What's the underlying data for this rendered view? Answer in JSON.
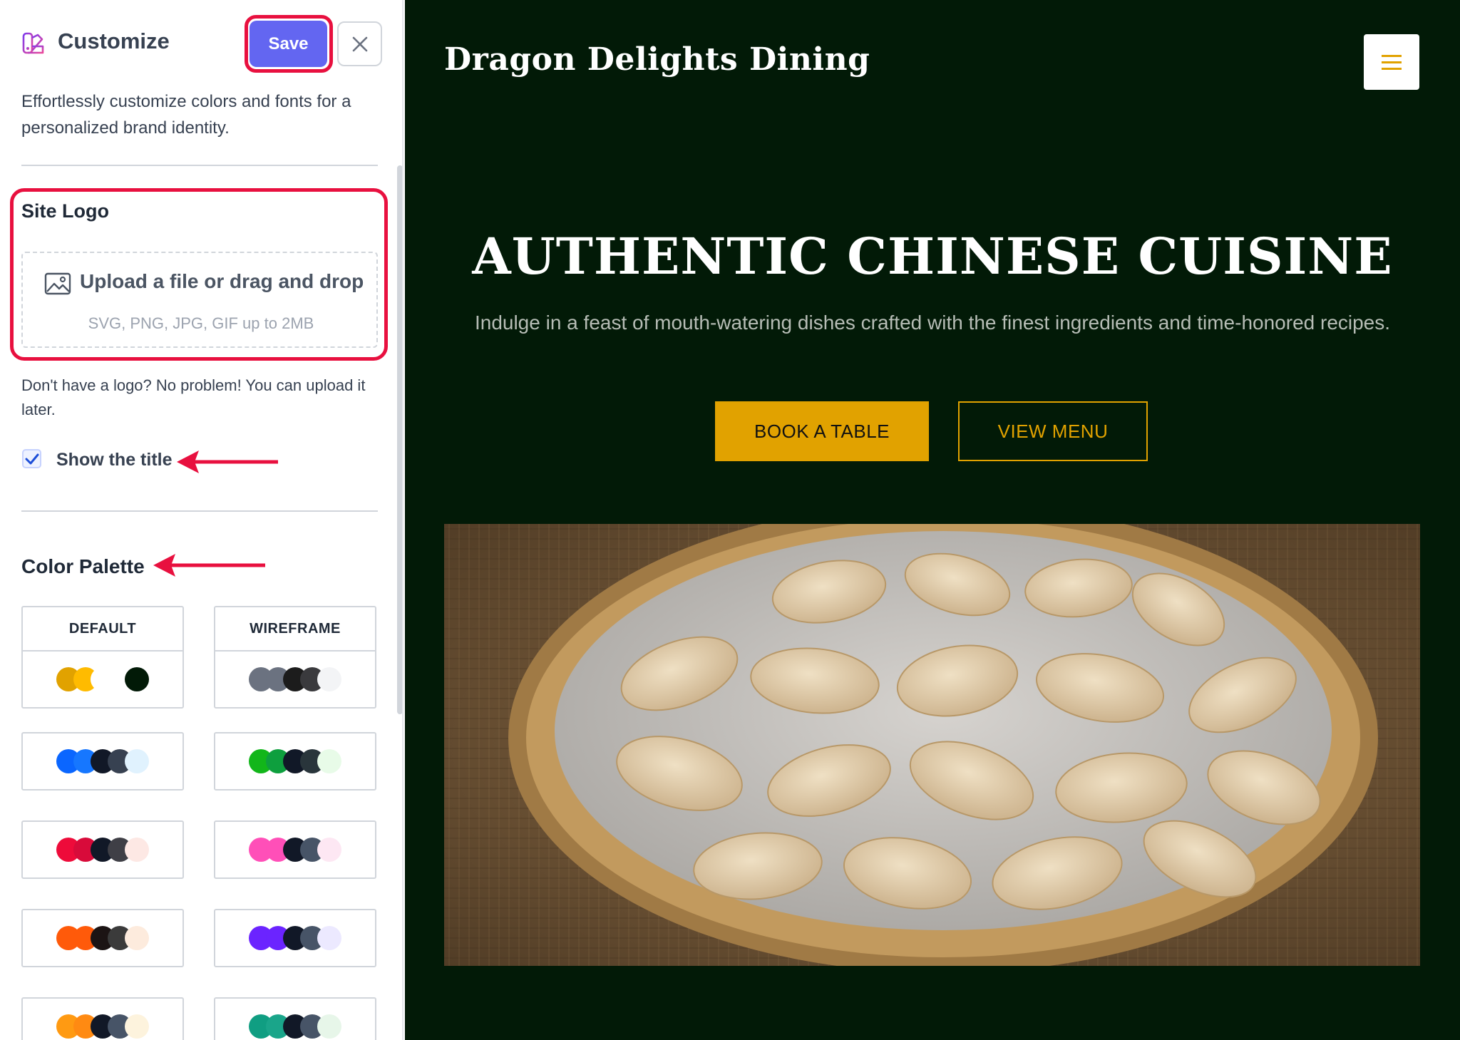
{
  "sidebar": {
    "title": "Customize",
    "save_label": "Save",
    "description": "Effortlessly customize colors and fonts for a personalized brand identity.",
    "site_logo": {
      "title": "Site Logo",
      "upload_text": "Upload a file or drag and drop",
      "upload_hint": "SVG, PNG, JPG, GIF up to 2MB",
      "note": "Don't have a logo? No problem! You can upload it later."
    },
    "show_title": {
      "label": "Show the title",
      "checked": true
    },
    "palette": {
      "title": "Color Palette",
      "options": [
        {
          "name": "DEFAULT",
          "colors": [
            "#e1a200",
            "#ffbb00",
            "#ffffff",
            "#ffffff",
            "#021a07"
          ]
        },
        {
          "name": "WIREFRAME",
          "colors": [
            "#6b7280",
            "#6b7280",
            "#1c1c1c",
            "#3a3a3d",
            "#f3f4f6"
          ]
        },
        {
          "name": "",
          "colors": [
            "#0a66ff",
            "#1677ff",
            "#111827",
            "#374151",
            "#e0f2fe"
          ]
        },
        {
          "name": "",
          "colors": [
            "#12b61a",
            "#0e9f3e",
            "#111827",
            "#29353b",
            "#e8fbe8"
          ]
        },
        {
          "name": "",
          "colors": [
            "#ee0b3a",
            "#d80b3a",
            "#111827",
            "#3f3f46",
            "#fde8e4"
          ]
        },
        {
          "name": "",
          "colors": [
            "#ff4fb8",
            "#ff4fb8",
            "#111827",
            "#475467",
            "#fde7f3"
          ]
        },
        {
          "name": "",
          "colors": [
            "#ff5a0a",
            "#ff5a0a",
            "#1c1414",
            "#3b3b3b",
            "#fdebdd"
          ]
        },
        {
          "name": "",
          "colors": [
            "#6b24ff",
            "#6b24ff",
            "#111827",
            "#475467",
            "#ece9ff"
          ]
        },
        {
          "name": "",
          "colors": [
            "#ff9a12",
            "#ff8a12",
            "#111827",
            "#475467",
            "#fdf3dd"
          ]
        },
        {
          "name": "",
          "colors": [
            "#109e82",
            "#1aa58a",
            "#111827",
            "#475467",
            "#e7f6e9"
          ]
        }
      ]
    }
  },
  "preview": {
    "site_title": "Dragon Delights Dining",
    "hero_title": "AUTHENTIC CHINESE CUISINE",
    "hero_subtitle": "Indulge in a feast of mouth-watering dishes crafted with the finest ingredients and time-honored recipes.",
    "book_label": "BOOK A TABLE",
    "menu_label": "VIEW MENU"
  },
  "colors": {
    "accent": "#6366f1",
    "highlight": "#e8103f",
    "preview_bg": "#021a07",
    "brand_gold": "#e1a200"
  },
  "icons": [
    "brush-icon",
    "close-icon",
    "image-icon",
    "check-icon",
    "menu-icon",
    "arrow-left-icon"
  ]
}
